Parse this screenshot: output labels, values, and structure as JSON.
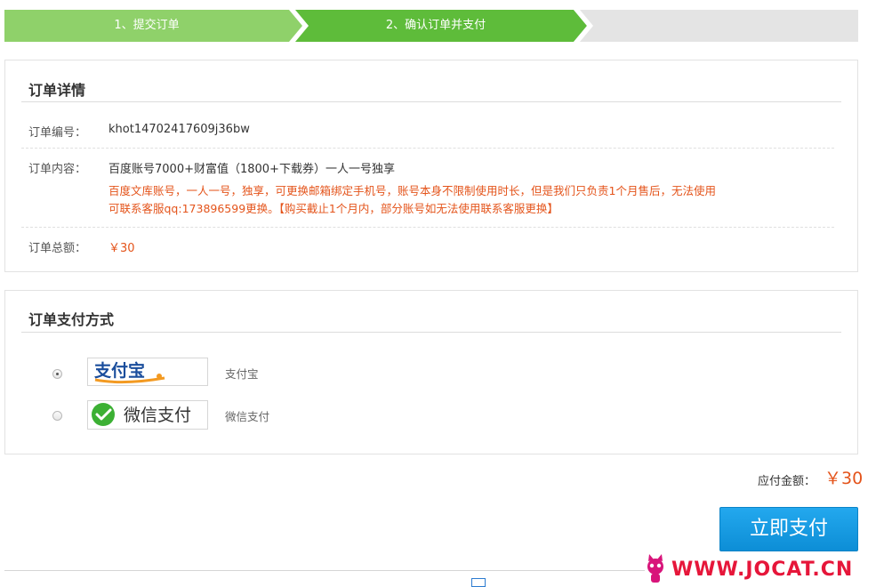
{
  "steps": [
    {
      "label": "1、提交订单",
      "color": "#8fd16a"
    },
    {
      "label": "2、确认订单并支付",
      "color": "#5ebc3a"
    }
  ],
  "order": {
    "title": "订单详情",
    "number_label": "订单编号：",
    "number": "khot14702417609j36bw",
    "content_label": "订单内容：",
    "content": "百度账号7000+财富值（1800+下载券）一人一号独享",
    "note_line1": "百度文库账号，一人一号，独享，可更换邮箱绑定手机号，账号本身不限制使用时长，但是我们只负责1个月售后，无法使用",
    "note_line2": "可联系客服qq:173896599更换。【购买截止1个月内，部分账号如无法使用联系客服更换】",
    "total_label": "订单总额：",
    "total": "￥30"
  },
  "payment": {
    "title": "订单支付方式",
    "options": [
      {
        "logo_text": "支付宝",
        "name": "支付宝",
        "selected": true
      },
      {
        "logo_text": "微信支付",
        "name": "微信支付",
        "selected": false
      }
    ]
  },
  "summary": {
    "due_label": "应付金额：",
    "due_value": "￥30",
    "pay_button": "立即支付"
  },
  "watermark": {
    "text": "WWW.JOCAT.CN"
  },
  "colors": {
    "accent_orange": "#e4541b",
    "button_blue": "#1a9be3",
    "wechat_green": "#3cb034"
  }
}
